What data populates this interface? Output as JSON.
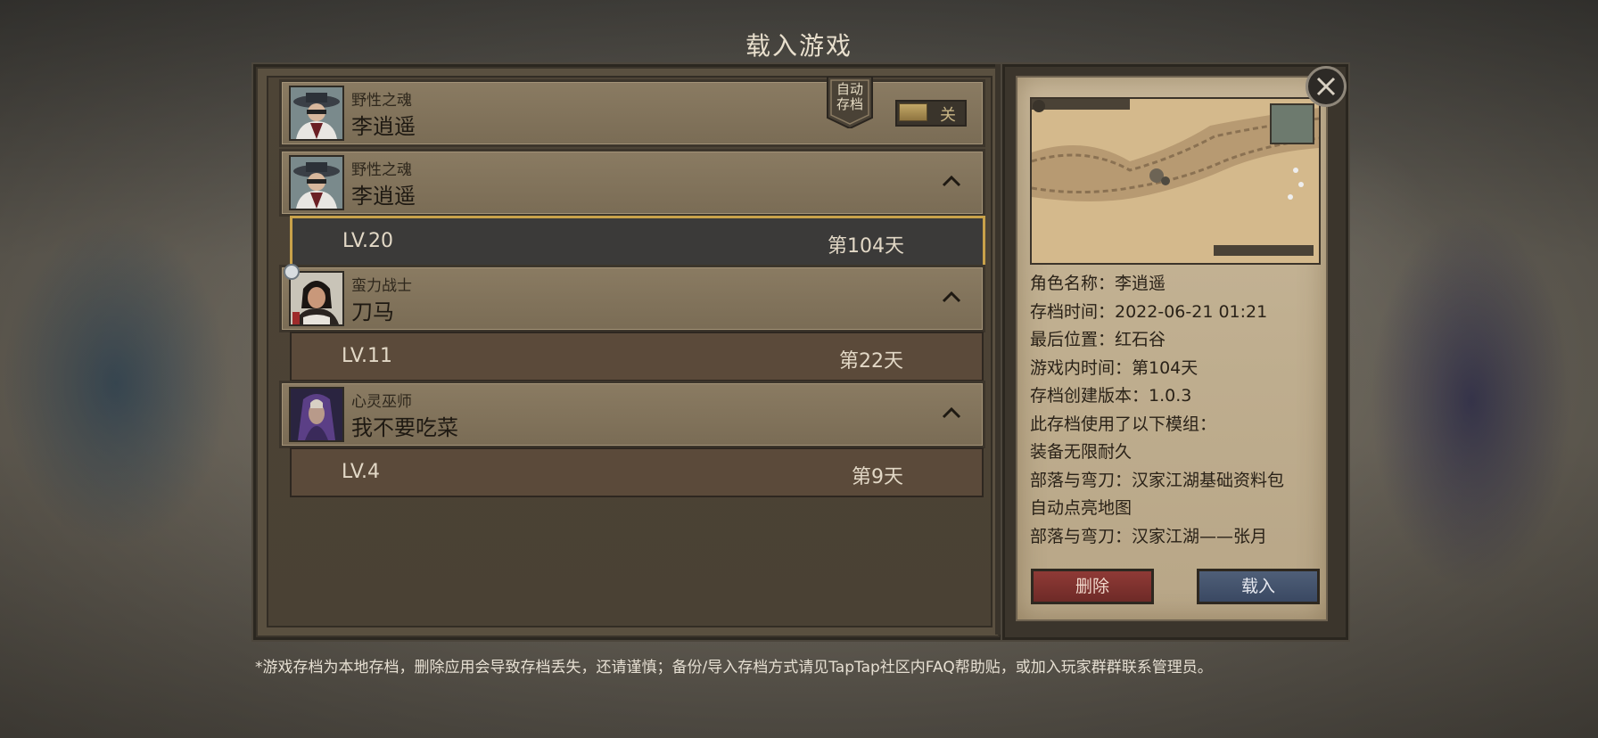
{
  "screen_title": "载入游戏",
  "autosave": {
    "class": "野性之魂",
    "name": "李逍遥",
    "badge_line1": "自动",
    "badge_line2": "存档",
    "toggle_label": "关"
  },
  "characters": [
    {
      "class": "野性之魂",
      "name": "李逍遥",
      "save": {
        "level": "LV.20",
        "day": "第104天"
      }
    },
    {
      "class": "蛮力战士",
      "name": "刀马",
      "save": {
        "level": "LV.11",
        "day": "第22天"
      }
    },
    {
      "class": "心灵巫师",
      "name": "我不要吃菜",
      "save": {
        "level": "LV.4",
        "day": "第9天"
      }
    }
  ],
  "details": {
    "lines": [
      "角色名称：李逍遥",
      "存档时间：2022-06-21 01:21",
      "最后位置：红石谷",
      "游戏内时间：第104天",
      "存档创建版本：1.0.3",
      "此存档使用了以下模组：",
      "装备无限耐久",
      "部落与弯刀：汉家江湖基础资料包",
      "自动点亮地图",
      "部落与弯刀：汉家江湖——张月"
    ],
    "delete_label": "删除",
    "load_label": "载入"
  },
  "close_icon": "close-icon",
  "footnote": "*游戏存档为本地存档，删除应用会导致存档丢失，还请谨慎；备份/导入存档方式请见TapTap社区内FAQ帮助贴，或加入玩家群群联系管理员。",
  "colors": {
    "selected_border": "#c9a24a",
    "delete": "#8f3a36",
    "load": "#4f5f78"
  }
}
